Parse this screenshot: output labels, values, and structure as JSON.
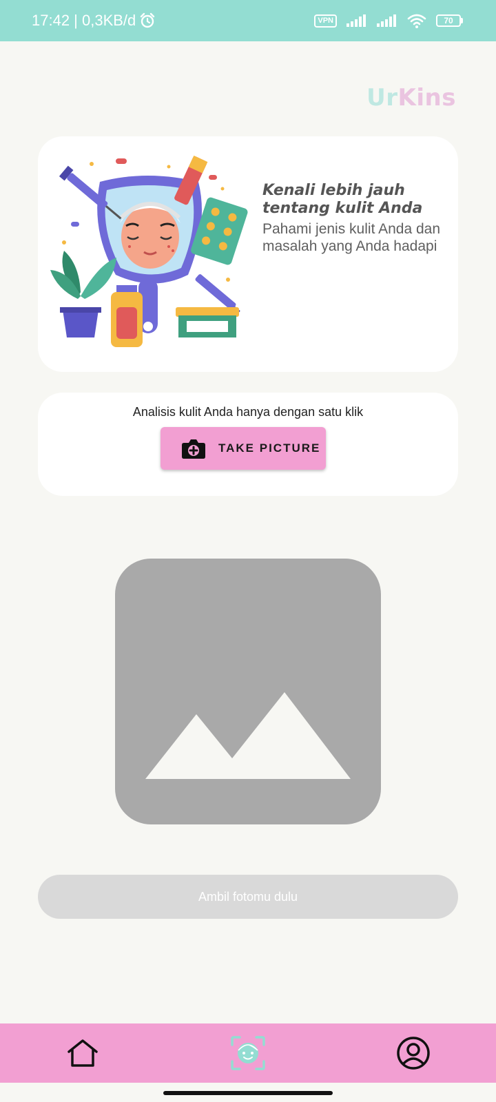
{
  "status_bar": {
    "time": "17:42",
    "network_speed": " | 0,3KB/d",
    "vpn": "VPN",
    "battery": "70"
  },
  "brand": {
    "part1": "Ur",
    "part2": "Kins"
  },
  "hero": {
    "title": "Kenali lebih jauh tentang kulit Anda",
    "subtitle": "Pahami jenis kulit Anda dan masalah yang Anda hadapi"
  },
  "action": {
    "caption": "Analisis kulit Anda hanya dengan satu klik",
    "take_picture_label": "TAKE PICTURE"
  },
  "primary_button": {
    "label": "Ambil fotomu dulu"
  },
  "nav": {
    "items": [
      {
        "icon": "home-icon"
      },
      {
        "icon": "face-scan-icon",
        "active": true
      },
      {
        "icon": "profile-icon"
      }
    ]
  },
  "colors": {
    "status_bar": "#93ddd2",
    "accent_pink": "#f29fd2",
    "background": "#f7f7f3",
    "placeholder": "#a9a9a9",
    "disabled_button": "#d9d9d9"
  }
}
